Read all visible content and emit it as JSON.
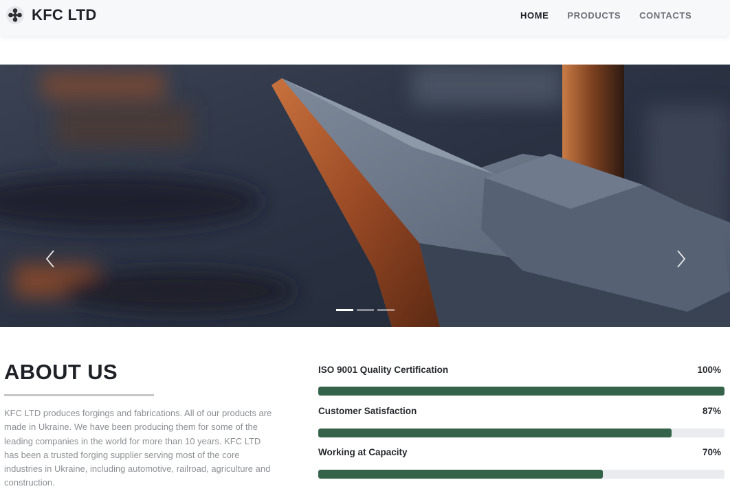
{
  "header": {
    "brand": "KFC LTD",
    "nav": [
      {
        "label": "HOME",
        "active": true
      },
      {
        "label": "PRODUCTS",
        "active": false
      },
      {
        "label": "CONTACTS",
        "active": false
      }
    ]
  },
  "carousel": {
    "slide_count": 3,
    "active_index": 0,
    "prev_icon": "chevron-left-icon",
    "next_icon": "chevron-right-icon"
  },
  "about": {
    "title": "ABOUT US",
    "lines": [
      "KFC LTD produces forgings and fabrications. All of our products are",
      "made in Ukraine. We have been producing them for some of the",
      "leading companies in the world for more than 10 years. KFC LTD",
      "has been a trusted forging supplier serving most of the core",
      "industries in Ukraine, including automotive, railroad, agriculture and",
      "construction."
    ]
  },
  "stats": [
    {
      "label": "ISO 9001 Quality Certification",
      "value_text": "100%",
      "percent": 100
    },
    {
      "label": "Customer Satisfaction",
      "value_text": "87%",
      "percent": 87
    },
    {
      "label": "Working at Capacity",
      "value_text": "70%",
      "percent": 70
    }
  ],
  "colors": {
    "bar_fill": "#35634a",
    "bar_track": "#e9ebee",
    "header_bg": "#f7f8fa"
  }
}
